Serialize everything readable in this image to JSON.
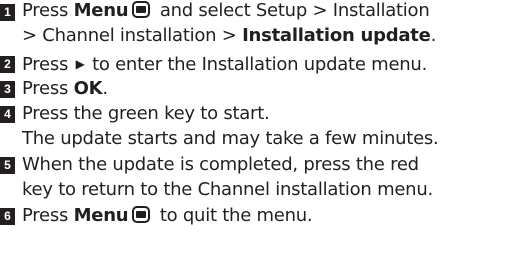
{
  "steps": [
    {
      "number": "1",
      "lines": [
        {
          "pre": "Press ",
          "bold1": "Menu",
          "mid": " and select Setup > Installation"
        },
        {
          "text": "> Channel installation > ",
          "bold": "Installation update",
          "post": "."
        }
      ]
    },
    {
      "number": "2",
      "lines": [
        {
          "pre": "Press ",
          "post": " to enter the Installation update menu."
        }
      ]
    },
    {
      "number": "3",
      "lines": [
        {
          "pre": "Press ",
          "bold": "OK",
          "post": "."
        }
      ]
    },
    {
      "number": "4",
      "lines": [
        {
          "text": "Press the green key to start."
        },
        {
          "text": "The update starts and may take a few minutes."
        }
      ]
    },
    {
      "number": "5",
      "lines": [
        {
          "text": "When the update is completed, press the red"
        },
        {
          "text": "key to return to the Channel installation menu."
        }
      ]
    },
    {
      "number": "6",
      "lines": [
        {
          "pre": "Press ",
          "bold": "Menu",
          "post": " to quit the menu."
        }
      ]
    }
  ],
  "icons": {
    "menu": "menu-key-icon",
    "right": "right-arrow-icon"
  }
}
